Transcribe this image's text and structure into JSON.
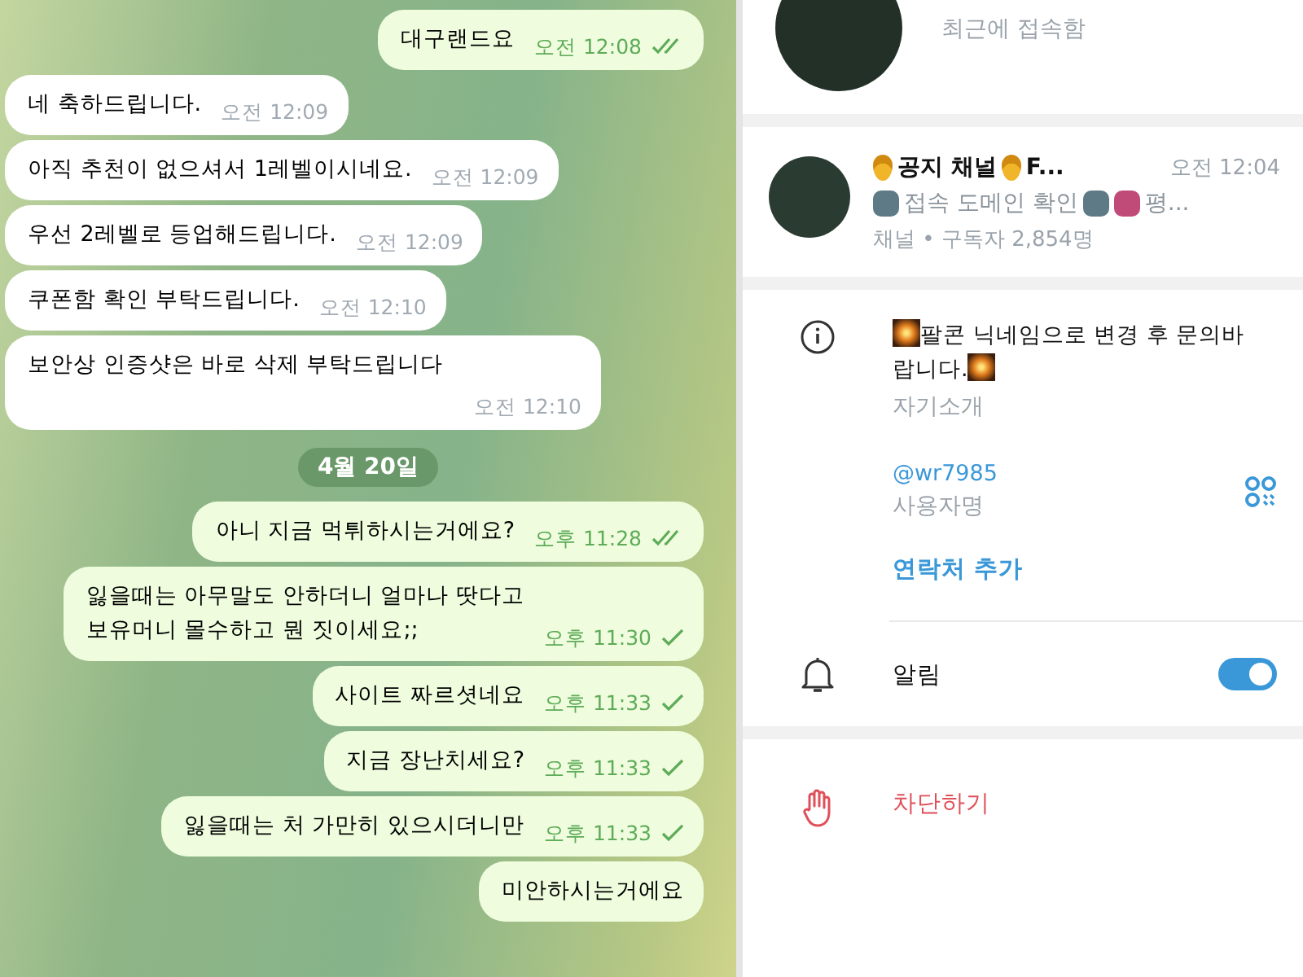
{
  "messages": [
    {
      "outgoing": true,
      "text": "대구랜드요",
      "time": "오전 12:08",
      "read": true
    },
    {
      "outgoing": false,
      "text": "네 축하드립니다.",
      "time": "오전 12:09"
    },
    {
      "outgoing": false,
      "text": "아직 추천이 없으셔서 1레벨이시네요.",
      "time": "오전 12:09"
    },
    {
      "outgoing": false,
      "text": "우선 2레벨로 등업해드립니다.",
      "time": "오전 12:09"
    },
    {
      "outgoing": false,
      "text": "쿠폰함 확인 부탁드립니다.",
      "time": "오전 12:10"
    },
    {
      "outgoing": false,
      "text": "보안상 인증샷은 바로 삭제 부탁드립니다",
      "time": "오전 12:10",
      "wide": true
    },
    {
      "kind": "date",
      "text": "4월 20일"
    },
    {
      "outgoing": true,
      "text": "아니 지금 먹튀하시는거에요?",
      "time": "오후 11:28",
      "read": true
    },
    {
      "outgoing": true,
      "text": "잃을때는 아무말도 안하더니 얼마나 땃다고\n보유머니 몰수하고 뭔 짓이세요;;",
      "time": "오후 11:30",
      "read": false
    },
    {
      "outgoing": true,
      "text": "사이트 짜르셧네요",
      "time": "오후 11:33",
      "read": false
    },
    {
      "outgoing": true,
      "text": "지금 장난치세요?",
      "time": "오후 11:33",
      "read": false
    },
    {
      "outgoing": true,
      "text": "잃을때는 처 가만히 있으시더니만",
      "time": "오후 11:33",
      "read": false
    },
    {
      "outgoing": true,
      "text": "미안하시는거에요"
    }
  ],
  "profile": {
    "status": "최근에 접속함"
  },
  "channel": {
    "name": "공지 채널",
    "name_tail": "F...",
    "time": "오전 12:04",
    "preview": "접속 도메인 확인",
    "preview_tail": "평...",
    "subtitle": "채널 • 구독자 2,854명"
  },
  "bio": {
    "text": "팔콘 닉네임으로 변경 후 문의바랍니다.",
    "label": "자기소개"
  },
  "username": {
    "value": "@wr7985",
    "label": "사용자명"
  },
  "add_contact": "연락처 추가",
  "notifications": {
    "label": "알림",
    "on": true
  },
  "block": "차단하기"
}
